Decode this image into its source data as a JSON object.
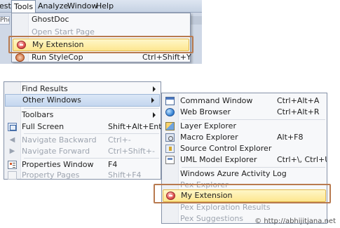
{
  "menubar": {
    "items": [
      "est",
      "Tools",
      "Analyze",
      "Window",
      "Help"
    ]
  },
  "toolstrip": {
    "clip_text": "Phc"
  },
  "tools_menu": {
    "items": [
      {
        "label": "GhostDoc",
        "shortcut": "",
        "icon": "none",
        "disabled": false
      },
      {
        "label": "Open Start Page",
        "shortcut": "",
        "icon": "none",
        "disabled": true
      },
      {
        "label": "My Extension",
        "shortcut": "",
        "icon": "record-icon",
        "disabled": false,
        "highlighted": true
      },
      {
        "label": "Run StyleCop",
        "shortcut": "Ctrl+Shift+Y",
        "icon": "stylecop-icon",
        "disabled": false
      }
    ]
  },
  "view_menu": {
    "items": [
      {
        "label": "Find Results",
        "shortcut": "",
        "submenu": true,
        "icon": "none",
        "disabled": false
      },
      {
        "label": "Other Windows",
        "shortcut": "",
        "submenu": true,
        "icon": "none",
        "disabled": false,
        "selected": true
      },
      {
        "label": "Toolbars",
        "shortcut": "",
        "submenu": true,
        "icon": "none",
        "disabled": false
      },
      {
        "label": "Full Screen",
        "shortcut": "Shift+Alt+Enter",
        "icon": "fullscreen-icon",
        "disabled": false
      },
      {
        "label": "Navigate Backward",
        "shortcut": "Ctrl+-",
        "icon": "navigate-backward-icon",
        "disabled": true
      },
      {
        "label": "Navigate Forward",
        "shortcut": "Ctrl+Shift+-",
        "icon": "navigate-forward-icon",
        "disabled": true
      },
      {
        "label": "Properties Window",
        "shortcut": "F4",
        "icon": "properties-icon",
        "disabled": false
      },
      {
        "label": "Property Pages",
        "shortcut": "Shift+F4",
        "icon": "property-pages-icon",
        "disabled": true
      }
    ]
  },
  "other_windows_menu": {
    "items": [
      {
        "label": "Command Window",
        "shortcut": "Ctrl+Alt+A",
        "icon": "command-window-icon",
        "disabled": false
      },
      {
        "label": "Web Browser",
        "shortcut": "Ctrl+Alt+R",
        "icon": "web-browser-icon",
        "disabled": false
      },
      {
        "label": "Layer Explorer",
        "shortcut": "",
        "icon": "layer-explorer-icon",
        "disabled": false
      },
      {
        "label": "Macro Explorer",
        "shortcut": "Alt+F8",
        "icon": "macro-explorer-icon",
        "disabled": false
      },
      {
        "label": "Source Control Explorer",
        "shortcut": "",
        "icon": "source-control-icon",
        "disabled": false
      },
      {
        "label": "UML Model Explorer",
        "shortcut": "Ctrl+\\, Ctrl+U",
        "icon": "uml-model-icon",
        "disabled": false
      },
      {
        "label": "Windows Azure Activity Log",
        "shortcut": "",
        "icon": "none",
        "disabled": false
      },
      {
        "label": "Pex Explorer",
        "shortcut": "",
        "icon": "none",
        "disabled": true
      },
      {
        "label": "My Extension",
        "shortcut": "",
        "icon": "record-icon",
        "disabled": false,
        "highlighted": true
      },
      {
        "label": "Pex Exploration Results",
        "shortcut": "",
        "icon": "none",
        "disabled": true
      },
      {
        "label": "Pex Suggestions",
        "shortcut": "",
        "icon": "none",
        "disabled": true
      }
    ]
  },
  "colors": {
    "highlight_fill": "#fde690",
    "highlight_border": "#e1b64b",
    "callout_border": "#b87a4f",
    "selected_fill": "#c4d7ef"
  },
  "watermark": "© http://abhijitjana.net"
}
